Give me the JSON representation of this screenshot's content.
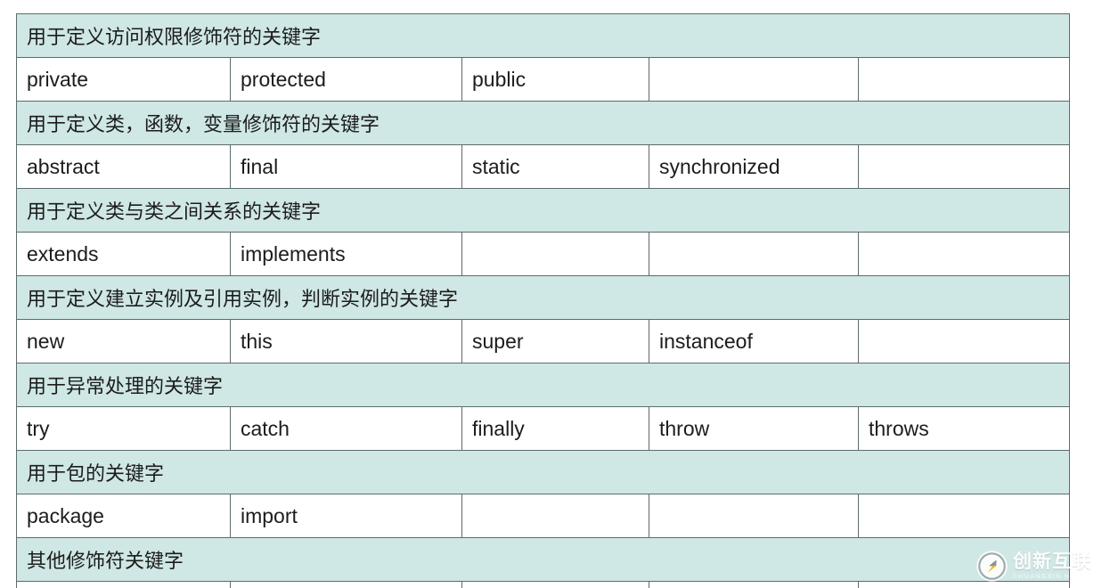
{
  "document": {
    "type": "keyword-reference-table",
    "columns": 5,
    "colors": {
      "section_row_bg": "#cfe7e5",
      "value_row_bg": "#ffffff",
      "border": "#5d6b6b",
      "text": "#1c1c1c",
      "watermark_text": "#e2e2e2"
    }
  },
  "watermarks": {
    "url": "https://blog.csdn.net/",
    "brand_name": "创新互联",
    "brand_pinyin": "CHUANGXIN HULIAN"
  },
  "table": {
    "rows": [
      {
        "kind": "section",
        "title": "用于定义访问权限修饰符的关键字"
      },
      {
        "kind": "keywords",
        "cells": [
          "private",
          "protected",
          "public",
          "",
          ""
        ]
      },
      {
        "kind": "section",
        "title": "用于定义类，函数，变量修饰符的关键字"
      },
      {
        "kind": "keywords",
        "cells": [
          "abstract",
          "final",
          "static",
          "synchronized",
          ""
        ]
      },
      {
        "kind": "section",
        "title": "用于定义类与类之间关系的关键字"
      },
      {
        "kind": "keywords",
        "cells": [
          "extends",
          "implements",
          "",
          "",
          ""
        ]
      },
      {
        "kind": "section",
        "title": "用于定义建立实例及引用实例，判断实例的关键字"
      },
      {
        "kind": "keywords",
        "cells": [
          "new",
          "this",
          "super",
          "instanceof",
          ""
        ]
      },
      {
        "kind": "section",
        "title": "用于异常处理的关键字"
      },
      {
        "kind": "keywords",
        "cells": [
          "try",
          "catch",
          "finally",
          "throw",
          "throws"
        ]
      },
      {
        "kind": "section",
        "title": "用于包的关键字"
      },
      {
        "kind": "keywords",
        "cells": [
          "package",
          "import",
          "",
          "",
          ""
        ]
      },
      {
        "kind": "section",
        "title": "其他修饰符关键字"
      },
      {
        "kind": "partial",
        "cells": [
          "",
          "",
          "",
          "",
          ""
        ]
      }
    ]
  }
}
